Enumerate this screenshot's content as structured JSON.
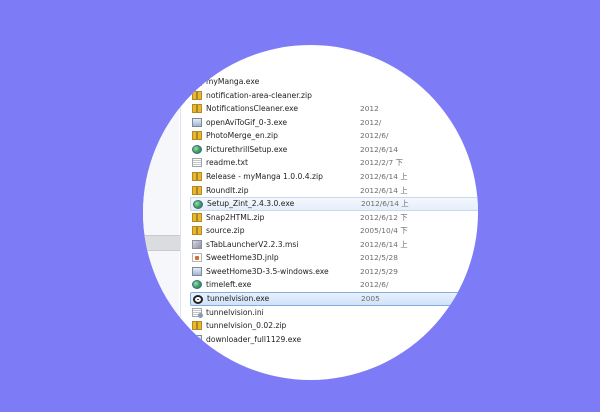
{
  "explorer": {
    "files": [
      {
        "name": "myManga.exe",
        "date": "",
        "icon": "manga-app-icon",
        "state": "normal"
      },
      {
        "name": "notification-area-cleaner.zip",
        "date": "",
        "icon": "zip-folder-icon",
        "state": "normal"
      },
      {
        "name": "NotificationsCleaner.exe",
        "date": "2012",
        "icon": "zip-folder-icon",
        "state": "normal"
      },
      {
        "name": "openAviToGif_0-3.exe",
        "date": "2012/",
        "icon": "application-icon",
        "state": "normal"
      },
      {
        "name": "PhotoMerge_en.zip",
        "date": "2012/6/",
        "icon": "zip-folder-icon",
        "state": "normal"
      },
      {
        "name": "PicturethrillSetup.exe",
        "date": "2012/6/14",
        "icon": "installer-globe-icon",
        "state": "normal"
      },
      {
        "name": "readme.txt",
        "date": "2012/2/7 下",
        "icon": "text-file-icon",
        "state": "normal"
      },
      {
        "name": "Release - myManga 1.0.0.4.zip",
        "date": "2012/6/14 上",
        "icon": "zip-folder-icon",
        "state": "normal"
      },
      {
        "name": "RoundIt.zip",
        "date": "2012/6/14 上",
        "icon": "zip-folder-icon",
        "state": "normal"
      },
      {
        "name": "Setup_Zint_2.4.3.0.exe",
        "date": "2012/6/14 上",
        "icon": "installer-globe-icon",
        "state": "hover"
      },
      {
        "name": "Snap2HTML.zip",
        "date": "2012/6/12 下",
        "icon": "zip-folder-icon",
        "state": "normal"
      },
      {
        "name": "source.zip",
        "date": "2005/10/4 下",
        "icon": "zip-folder-icon",
        "state": "normal"
      },
      {
        "name": "sTabLauncherV2.2.3.msi",
        "date": "2012/6/14 上",
        "icon": "msi-package-icon",
        "state": "normal"
      },
      {
        "name": "SweetHome3D.jnlp",
        "date": "2012/5/28",
        "icon": "jnlp-file-icon",
        "state": "normal"
      },
      {
        "name": "SweetHome3D-3.5-windows.exe",
        "date": "2012/5/29",
        "icon": "application-icon",
        "state": "normal"
      },
      {
        "name": "timeleft.exe",
        "date": "2012/6/",
        "icon": "installer-globe-icon",
        "state": "normal"
      },
      {
        "name": "tunnelvision.exe",
        "date": "2005",
        "icon": "target-app-icon",
        "state": "selected"
      },
      {
        "name": "tunnelvision.ini",
        "date": "",
        "icon": "settings-file-icon",
        "state": "normal"
      },
      {
        "name": "tunnelvision_0.02.zip",
        "date": "",
        "icon": "zip-folder-icon",
        "state": "normal"
      },
      {
        "name": "downloader_full1129.exe",
        "date": "",
        "icon": "application-icon",
        "state": "normal"
      }
    ]
  },
  "colors": {
    "background": "#7d7cf6",
    "selection_border": "#84acdd",
    "selection_fill": "#cfe2fa"
  }
}
